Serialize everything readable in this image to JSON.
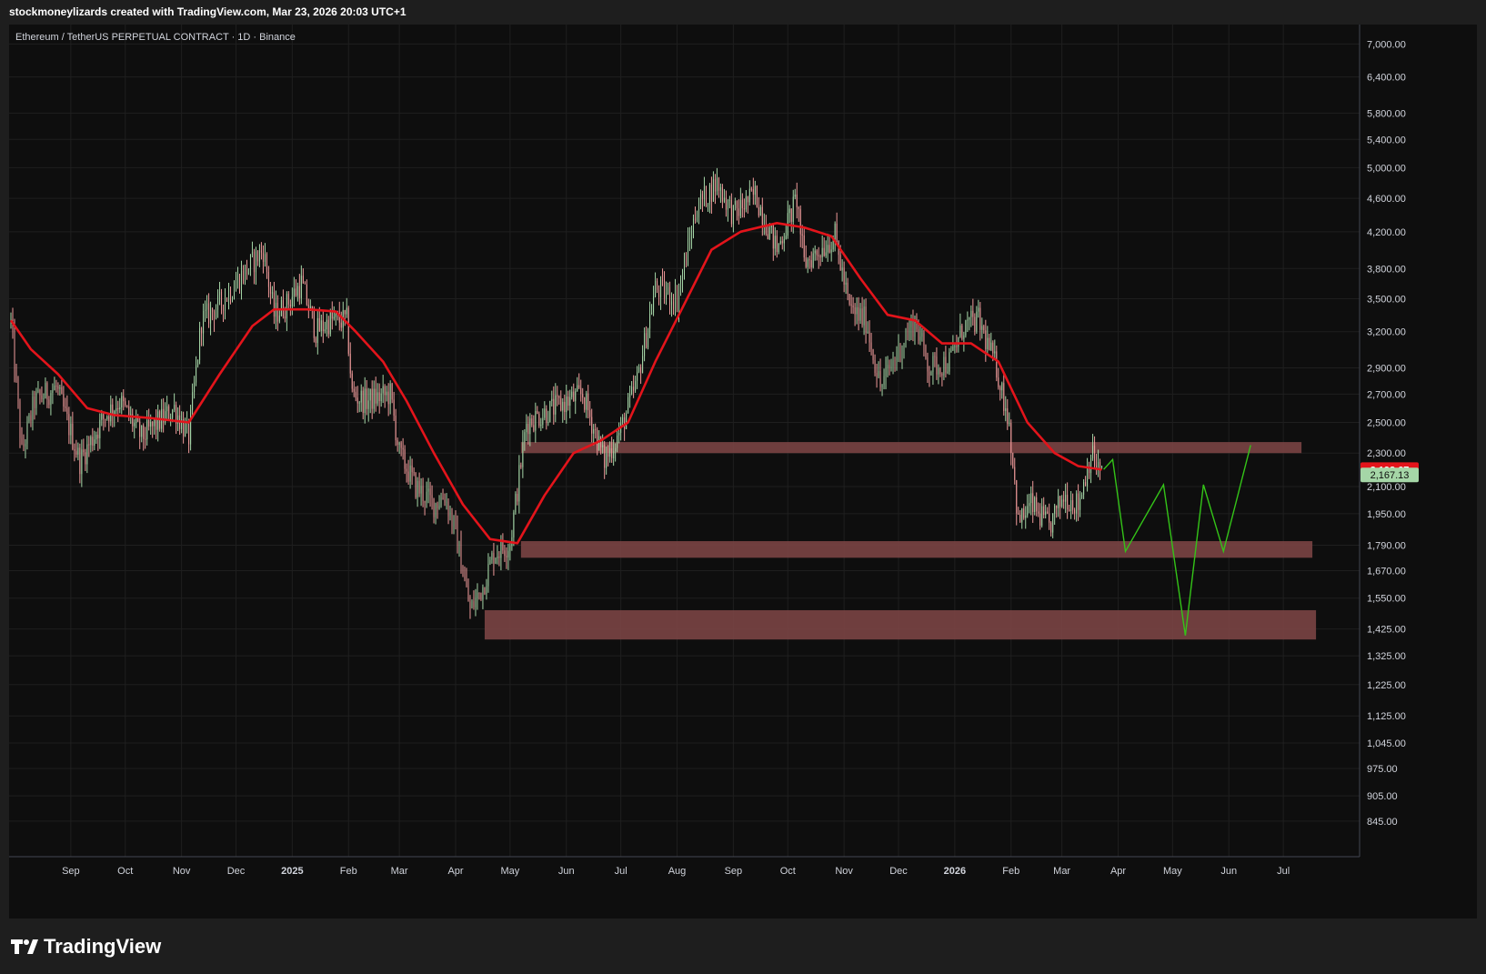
{
  "header": {
    "attribution": "stockmoneylizards created with TradingView.com, Mar 23, 2026 20:03 UTC+1"
  },
  "footer": {
    "brand_name": "TradingView",
    "logo_icon": "tradingview-logo-icon"
  },
  "colors": {
    "background": "#0e0e0e",
    "frame": "#1e1e1e",
    "grid": "#1f1f1f",
    "up_candle": "#a5d6a7",
    "down_candle": "#ef9a9a",
    "moving_average": "#e3141b",
    "support_zone": "#7a4444",
    "projection": "#34c418",
    "axis_text": "#d1d4dc",
    "ma_label_bg": "#e3141b",
    "price_label_bg": "#a5d6a7"
  },
  "chart_data": {
    "type": "candlestick",
    "title": "Ethereum / TetherUS PERPETUAL CONTRACT · 1D · Binance",
    "y_scale": "log",
    "ylim": [
      800,
      7200
    ],
    "xlim": [
      "2024-07-30",
      "2026-08-07"
    ],
    "grid": true,
    "legend": "none",
    "y_ticks": [
      "7,000.00",
      "6,400.00",
      "5,800.00",
      "5,400.00",
      "5,000.00",
      "4,600.00",
      "4,200.00",
      "3,800.00",
      "3,500.00",
      "3,200.00",
      "2,900.00",
      "2,700.00",
      "2,500.00",
      "2,300.00",
      "2,100.00",
      "1,950.00",
      "1,790.00",
      "1,670.00",
      "1,550.00",
      "1,425.00",
      "1,325.00",
      "1,225.00",
      "1,125.00",
      "1,045.00",
      "975.00",
      "905.00",
      "845.00"
    ],
    "x_ticks": [
      {
        "label": "Sep",
        "date": "2024-09-01"
      },
      {
        "label": "Oct",
        "date": "2024-10-01"
      },
      {
        "label": "Nov",
        "date": "2024-11-01"
      },
      {
        "label": "Dec",
        "date": "2024-12-01"
      },
      {
        "label": "2025",
        "date": "2025-01-01",
        "bold": true
      },
      {
        "label": "Feb",
        "date": "2025-02-01"
      },
      {
        "label": "Mar",
        "date": "2025-03-01"
      },
      {
        "label": "Apr",
        "date": "2025-04-01"
      },
      {
        "label": "May",
        "date": "2025-05-01"
      },
      {
        "label": "Jun",
        "date": "2025-06-01"
      },
      {
        "label": "Jul",
        "date": "2025-07-01"
      },
      {
        "label": "Aug",
        "date": "2025-08-01"
      },
      {
        "label": "Sep",
        "date": "2025-09-01"
      },
      {
        "label": "Oct",
        "date": "2025-10-01"
      },
      {
        "label": "Nov",
        "date": "2025-11-01"
      },
      {
        "label": "Dec",
        "date": "2025-12-01"
      },
      {
        "label": "2026",
        "date": "2026-01-01",
        "bold": true
      },
      {
        "label": "Feb",
        "date": "2026-02-01"
      },
      {
        "label": "Mar",
        "date": "2026-03-01"
      },
      {
        "label": "Apr",
        "date": "2026-04-01"
      },
      {
        "label": "May",
        "date": "2026-05-01"
      },
      {
        "label": "Jun",
        "date": "2026-06-01"
      },
      {
        "label": "Jul",
        "date": "2026-07-01"
      }
    ],
    "price_anchors": [
      [
        "2024-07-30",
        3300
      ],
      [
        "2024-08-05",
        2300
      ],
      [
        "2024-08-12",
        2650
      ],
      [
        "2024-08-24",
        2750
      ],
      [
        "2024-09-06",
        2250
      ],
      [
        "2024-09-20",
        2550
      ],
      [
        "2024-09-28",
        2650
      ],
      [
        "2024-10-10",
        2400
      ],
      [
        "2024-10-28",
        2600
      ],
      [
        "2024-11-05",
        2400
      ],
      [
        "2024-11-12",
        3300
      ],
      [
        "2024-11-22",
        3450
      ],
      [
        "2024-12-03",
        3700
      ],
      [
        "2024-12-16",
        4000
      ],
      [
        "2024-12-22",
        3350
      ],
      [
        "2024-12-29",
        3450
      ],
      [
        "2025-01-06",
        3650
      ],
      [
        "2025-01-14",
        3200
      ],
      [
        "2025-01-22",
        3300
      ],
      [
        "2025-01-31",
        3300
      ],
      [
        "2025-02-03",
        2700
      ],
      [
        "2025-02-10",
        2650
      ],
      [
        "2025-02-24",
        2700
      ],
      [
        "2025-03-01",
        2300
      ],
      [
        "2025-03-10",
        2100
      ],
      [
        "2025-03-20",
        2000
      ],
      [
        "2025-03-26",
        2050
      ],
      [
        "2025-04-01",
        1850
      ],
      [
        "2025-04-09",
        1500
      ],
      [
        "2025-04-16",
        1600
      ],
      [
        "2025-04-22",
        1750
      ],
      [
        "2025-05-01",
        1800
      ],
      [
        "2025-05-10",
        2500
      ],
      [
        "2025-05-25",
        2600
      ],
      [
        "2025-06-10",
        2700
      ],
      [
        "2025-06-22",
        2250
      ],
      [
        "2025-07-01",
        2450
      ],
      [
        "2025-07-10",
        2800
      ],
      [
        "2025-07-20",
        3600
      ],
      [
        "2025-08-01",
        3500
      ],
      [
        "2025-08-12",
        4500
      ],
      [
        "2025-08-23",
        4800
      ],
      [
        "2025-09-01",
        4400
      ],
      [
        "2025-09-13",
        4650
      ],
      [
        "2025-09-25",
        4000
      ],
      [
        "2025-10-06",
        4600
      ],
      [
        "2025-10-10",
        3850
      ],
      [
        "2025-10-27",
        4150
      ],
      [
        "2025-11-04",
        3400
      ],
      [
        "2025-11-13",
        3300
      ],
      [
        "2025-11-21",
        2750
      ],
      [
        "2025-12-03",
        3100
      ],
      [
        "2025-12-10",
        3300
      ],
      [
        "2025-12-18",
        2900
      ],
      [
        "2025-12-29",
        2950
      ],
      [
        "2026-01-06",
        3250
      ],
      [
        "2026-01-14",
        3300
      ],
      [
        "2026-01-24",
        2900
      ],
      [
        "2026-01-31",
        2500
      ],
      [
        "2026-02-05",
        1900
      ],
      [
        "2026-02-12",
        2000
      ],
      [
        "2026-02-22",
        1880
      ],
      [
        "2026-03-02",
        2050
      ],
      [
        "2026-03-10",
        2000
      ],
      [
        "2026-03-17",
        2300
      ],
      [
        "2026-03-23",
        2167
      ]
    ],
    "moving_average": {
      "name": "",
      "points": [
        [
          "2024-07-30",
          3300
        ],
        [
          "2024-08-10",
          3050
        ],
        [
          "2024-08-25",
          2850
        ],
        [
          "2024-09-10",
          2600
        ],
        [
          "2024-09-25",
          2550
        ],
        [
          "2024-10-15",
          2530
        ],
        [
          "2024-11-05",
          2500
        ],
        [
          "2024-11-22",
          2850
        ],
        [
          "2024-12-10",
          3250
        ],
        [
          "2024-12-22",
          3400
        ],
        [
          "2025-01-10",
          3400
        ],
        [
          "2025-01-25",
          3380
        ],
        [
          "2025-02-05",
          3200
        ],
        [
          "2025-02-20",
          2950
        ],
        [
          "2025-03-05",
          2650
        ],
        [
          "2025-03-20",
          2300
        ],
        [
          "2025-04-05",
          2000
        ],
        [
          "2025-04-20",
          1820
        ],
        [
          "2025-05-05",
          1800
        ],
        [
          "2025-05-20",
          2050
        ],
        [
          "2025-06-05",
          2300
        ],
        [
          "2025-06-20",
          2380
        ],
        [
          "2025-07-05",
          2500
        ],
        [
          "2025-07-20",
          2950
        ],
        [
          "2025-08-05",
          3450
        ],
        [
          "2025-08-20",
          4000
        ],
        [
          "2025-09-05",
          4200
        ],
        [
          "2025-09-25",
          4300
        ],
        [
          "2025-10-10",
          4250
        ],
        [
          "2025-10-25",
          4150
        ],
        [
          "2025-11-10",
          3700
        ],
        [
          "2025-11-25",
          3350
        ],
        [
          "2025-12-10",
          3300
        ],
        [
          "2025-12-25",
          3100
        ],
        [
          "2026-01-10",
          3100
        ],
        [
          "2026-01-25",
          2950
        ],
        [
          "2026-02-10",
          2500
        ],
        [
          "2026-02-25",
          2300
        ],
        [
          "2026-03-10",
          2220
        ],
        [
          "2026-03-23",
          2198.67
        ]
      ]
    },
    "zones": [
      {
        "from": "2025-05-07",
        "to": "2026-07-11",
        "low": 2300,
        "high": 2370
      },
      {
        "from": "2025-05-07",
        "to": "2026-07-17",
        "low": 1730,
        "high": 1810
      },
      {
        "from": "2025-04-17",
        "to": "2026-07-19",
        "low": 1385,
        "high": 1500
      }
    ],
    "projection": [
      [
        "2026-03-24",
        2200
      ],
      [
        "2026-03-29",
        2260
      ],
      [
        "2026-04-05",
        1760
      ],
      [
        "2026-04-26",
        2110
      ],
      [
        "2026-05-08",
        1400
      ],
      [
        "2026-05-18",
        2110
      ],
      [
        "2026-05-29",
        1760
      ],
      [
        "2026-06-13",
        2350
      ]
    ],
    "last_values": {
      "moving_average": "2,198.67",
      "price": "2,167.13"
    }
  }
}
